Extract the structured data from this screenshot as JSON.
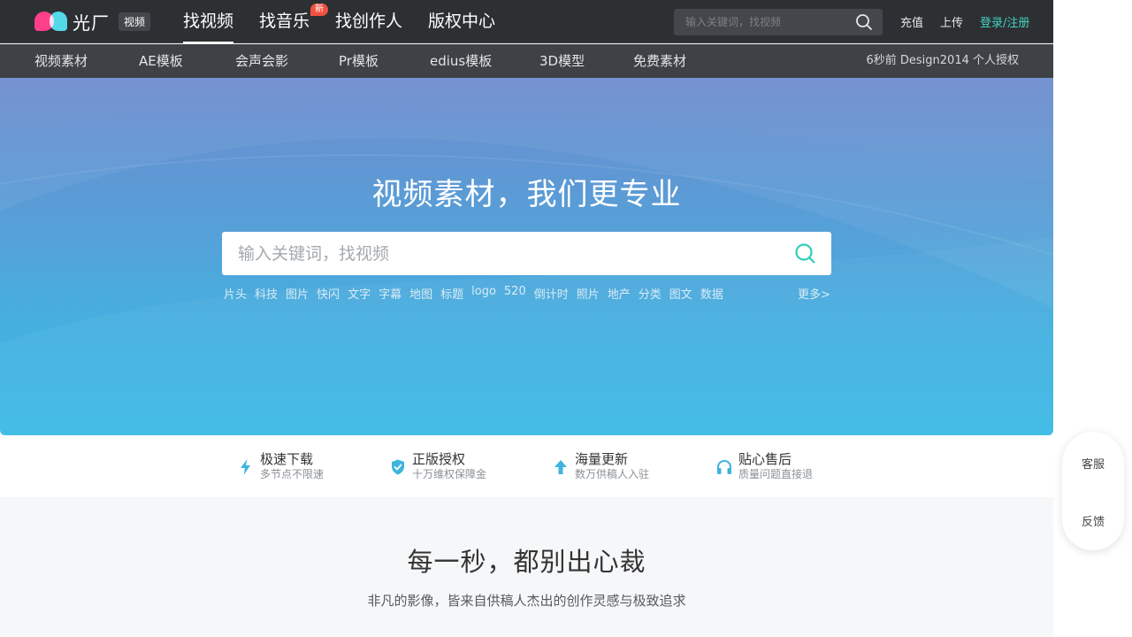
{
  "brand": {
    "name": "光厂",
    "badge": "视频"
  },
  "main_nav": [
    {
      "label": "找视频",
      "active": true
    },
    {
      "label": "找音乐",
      "badge": "新"
    },
    {
      "label": "找创作人"
    },
    {
      "label": "版权中心"
    }
  ],
  "top_search": {
    "placeholder": "输入关键词，找视频"
  },
  "top_links": {
    "recharge": "充值",
    "upload": "上传",
    "login": "登录/注册"
  },
  "sub_nav": [
    "视频素材",
    "AE模板",
    "会声会影",
    "Pr模板",
    "edius模板",
    "3D模型",
    "免费素材"
  ],
  "notice": "6秒前 Design2014 个人授权",
  "hero": {
    "title": "视频素材，我们更专业",
    "search_placeholder": "输入关键词，找视频",
    "hot_tags": [
      "片头",
      "科技",
      "图片",
      "快闪",
      "文字",
      "字幕",
      "地图",
      "标题",
      "logo",
      "520",
      "倒计时",
      "照片",
      "地产",
      "分类",
      "图文",
      "数据"
    ],
    "more": "更多>"
  },
  "features": [
    {
      "title": "极速下载",
      "sub": "多节点不限速",
      "icon": "lightning-icon"
    },
    {
      "title": "正版授权",
      "sub": "十万维权保障金",
      "icon": "shield-check-icon"
    },
    {
      "title": "海量更新",
      "sub": "数万供稿人入驻",
      "icon": "arrow-up-icon"
    },
    {
      "title": "贴心售后",
      "sub": "质量问题直接退",
      "icon": "headphones-icon"
    }
  ],
  "section": {
    "title": "每一秒，都别出心裁",
    "subtitle": "非凡的影像，皆来自供稿人杰出的创作灵感与极致追求"
  },
  "side_widget": {
    "service": "客服",
    "feedback": "反馈"
  },
  "colors": {
    "accent": "#43d3c2",
    "topbar": "#2d3033",
    "subbar": "#3e4246",
    "hero_top": "#6e8cce",
    "hero_bottom": "#3dbbe4",
    "icon_blue": "#3fb4de",
    "new_badge": "#f2503f"
  }
}
